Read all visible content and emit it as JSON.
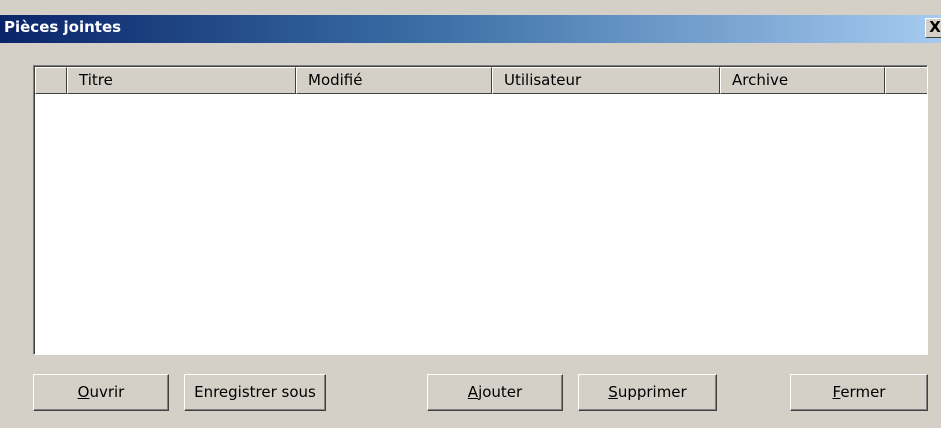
{
  "window": {
    "title": "Pièces jointes",
    "close_glyph": "X"
  },
  "list": {
    "columns": [
      {
        "label": ""
      },
      {
        "label": "Titre"
      },
      {
        "label": "Modifié"
      },
      {
        "label": "Utilisateur"
      },
      {
        "label": "Archive"
      },
      {
        "label": ""
      }
    ],
    "rows": []
  },
  "buttons": {
    "ouvrir": {
      "mnemonic": "O",
      "rest": "uvrir"
    },
    "enregistrer": {
      "label": "Enregistrer sous"
    },
    "ajouter": {
      "mnemonic": "A",
      "rest": "jouter"
    },
    "supprimer": {
      "mnemonic": "S",
      "rest": "upprimer"
    },
    "fermer": {
      "mnemonic": "F",
      "rest": "ermer"
    }
  },
  "colors": {
    "title_gradient_start": "#0a246a",
    "title_gradient_end": "#a6caf0",
    "face": "#d4d0c8"
  }
}
